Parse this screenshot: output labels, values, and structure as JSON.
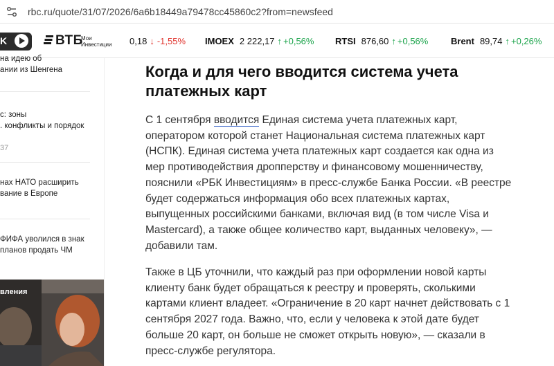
{
  "browser": {
    "url": "rbc.ru/quote/31/07/2026/6a6b18449a79478cc45860c2?from=newsfeed"
  },
  "ticker": {
    "partial_button_label": "K",
    "logo_name": "ВТБ",
    "logo_sub_line1": "Мои",
    "logo_sub_line2": "Инвестиции",
    "items": [
      {
        "name": "",
        "value": "0,18",
        "change": "-1,55%",
        "direction": "down"
      },
      {
        "name": "IMOEX",
        "value": "2 222,17",
        "change": "+0,56%",
        "direction": "up"
      },
      {
        "name": "RTSI",
        "value": "876,60",
        "change": "+0,56%",
        "direction": "up"
      },
      {
        "name": "Brent",
        "value": "89,74",
        "change": "+0,26%",
        "direction": "up"
      }
    ],
    "colors": {
      "down": "#e0312b",
      "up": "#1aa34a"
    }
  },
  "sidebar": {
    "items": [
      {
        "line1": "на идею об",
        "line2": "ании из Шенгена"
      },
      {
        "line1": "с: зоны",
        "line2": ". конфликты и порядок",
        "meta": "37"
      },
      {
        "line1": "нах НАТО расширить",
        "line2": "вание в Европе"
      },
      {
        "line1": "ФИФА уволился в знак",
        "line2": "планов продать ЧМ"
      }
    ],
    "promo_label": "вления"
  },
  "article": {
    "title_line1": "Когда и для чего вводится система учета",
    "title_line2": "платежных карт",
    "p1_prefix": "С 1 сентября ",
    "p1_link": "вводится",
    "p1_lines": [
      " Единая система учета платежных карт,",
      "оператором которой станет Национальная система платежных карт",
      "(НСПК). Единая система учета платежных карт создается как одна из",
      "мер противодействия дропперству и финансовому мошенничеству,",
      "пояснили «РБК Инвестициям» в пресс-службе Банка России. «В реестре",
      "будет содержаться информация обо всех платежных картах,",
      "выпущенных российскими банками, включая вид (в том числе Visa и",
      "Mastercard), а также общее количество карт, выданных человеку», —",
      "добавили там."
    ],
    "p2_lines": [
      "Также в ЦБ уточнили, что каждый раз при оформлении новой карты",
      "клиенту банк будет обращаться к реестру и проверять, сколькими",
      "картами клиент владеет. «Ограничение в 20 карт начнет действовать с 1",
      "сентября 2027 года. Важно, что, если у человека к этой дате будет",
      "больше 20 карт, он больше не сможет открыть новую», — сказали в",
      "пресс-службе регулятора."
    ]
  }
}
